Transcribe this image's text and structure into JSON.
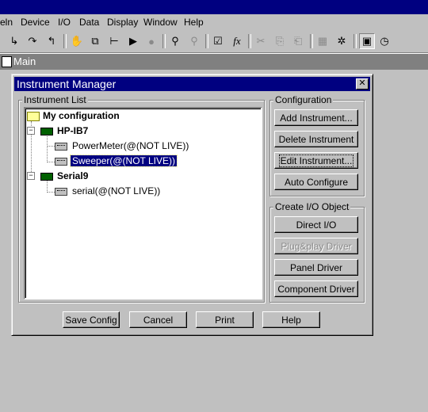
{
  "menu": {
    "help_fragment": "eln",
    "device": "Device",
    "io": "I/O",
    "data": "Data",
    "display": "Display",
    "window": "Window",
    "help": "Help"
  },
  "toolbar": {
    "icons": [
      "step-into-icon",
      "step-over-icon",
      "step-out-icon",
      "hand-icon",
      "copy-objects-icon",
      "connect-icon",
      "run-icon",
      "find-icon",
      "properties-icon",
      "function-icon",
      "cut-icon",
      "copy-icon",
      "paste-icon",
      "panel-icon",
      "debug-icon",
      "show-panel-icon",
      "timer-icon"
    ],
    "function_glyph": "fx"
  },
  "main_window": {
    "title": "Main"
  },
  "dialog": {
    "title": "Instrument Manager",
    "close_glyph": "✕",
    "instrument_list_label": "Instrument List",
    "configuration_label": "Configuration",
    "create_io_label": "Create I/O Object",
    "tree": {
      "root": "My configuration",
      "bus1": "HP-IB7",
      "bus1_child1": "PowerMeter(@(NOT LIVE))",
      "bus1_child2": "Sweeper(@(NOT LIVE))",
      "bus2": "Serial9",
      "bus2_child1": "serial(@(NOT LIVE))",
      "expander_glyph": "−"
    },
    "config_buttons": {
      "add": "Add Instrument...",
      "delete": "Delete Instrument",
      "edit": "Edit Instrument...",
      "auto": "Auto Configure"
    },
    "io_buttons": {
      "direct": "Direct I/O",
      "plugplay": "Plug&play Driver",
      "panel": "Panel Driver",
      "component": "Component Driver"
    },
    "bottom_buttons": {
      "save": "Save Config",
      "cancel": "Cancel",
      "print": "Print",
      "help": "Help"
    }
  }
}
